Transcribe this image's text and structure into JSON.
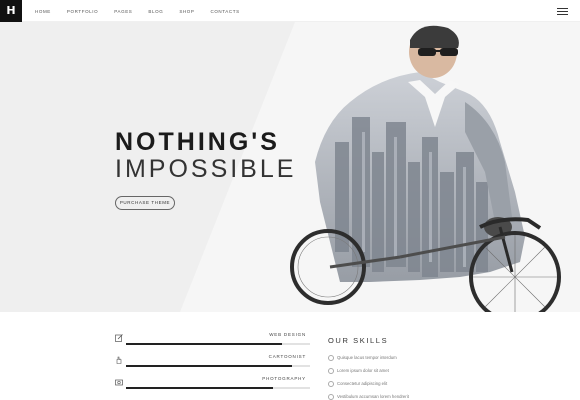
{
  "nav": {
    "logo": "H",
    "items": [
      "HOME",
      "PORTFOLIO",
      "PAGES",
      "BLOG",
      "SHOP",
      "CONTACTS"
    ]
  },
  "hero": {
    "title": "NOTHING'S",
    "subtitle": "IMPOSSIBLE",
    "button": "PURCHASE THEME"
  },
  "skills_left": [
    {
      "label": "WEB DESIGN",
      "icon": "pen-icon",
      "level": 0.85
    },
    {
      "label": "CARTOONIST",
      "icon": "hand-icon",
      "level": 0.9
    },
    {
      "label": "PHOTOGRAPHY",
      "icon": "camera-icon",
      "level": 0.8
    }
  ],
  "skills_right": {
    "heading": "OUR SKILLS",
    "items": [
      "Quisque lacus tempor interdum",
      "Lorem ipsum dolor sit amet",
      "Consectetur adipiscing elit",
      "Vestibulum accumsan lorem hendrerit"
    ]
  },
  "colors": {
    "dark": "#111111",
    "accent": "#222222",
    "hero_bg": "#efefef"
  }
}
